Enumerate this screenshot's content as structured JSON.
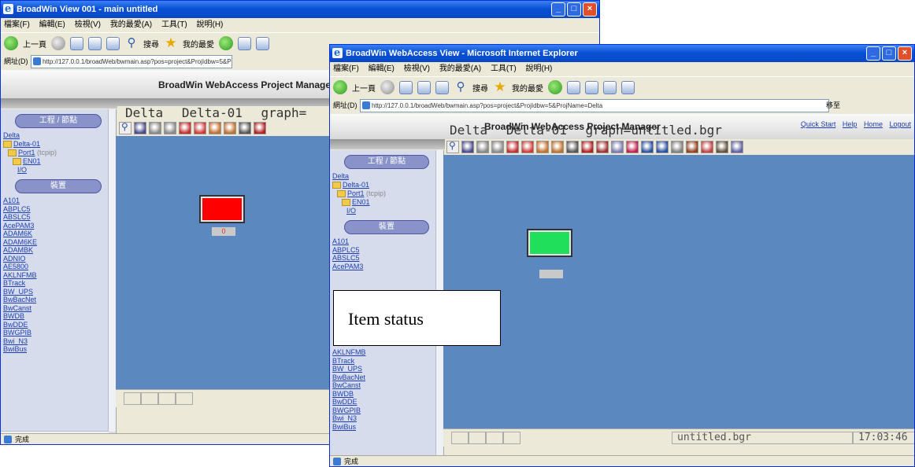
{
  "back_window": {
    "title": "BroadWin View 001 - main untitled",
    "menu": [
      "檔案(F)",
      "編輯(E)",
      "檢視(V)",
      "我的最愛(A)",
      "工具(T)",
      "說明(H)"
    ],
    "back_label": "上一頁",
    "search_label": "搜尋",
    "favorites_label": "我的最愛",
    "address_label": "網址(D)",
    "address_value": "http://127.0.0.1/broadWeb/bwmain.asp?pos=project&ProjIdbw=5&ProjName=Delta",
    "page_title": "BroadWin WebAccess Project Manage",
    "left_heading": "工程 / 節點",
    "tree": {
      "root": "Delta",
      "node": "Delta-01",
      "port": "Port1",
      "port_note": "(tcpip)",
      "device": "EN01",
      "io": "I/O"
    },
    "device_heading": "裝置",
    "device_list": [
      "A101",
      "ABPLC5",
      "ABSLC5",
      "AcePAM3",
      "ADAM6K",
      "ADAM6KE",
      "ADAMBK",
      "ADNIO",
      "AE5800",
      "AKLNFMB",
      "BTrack",
      "BW_UPS",
      "BwBacNet",
      "BwCanst",
      "BWDB",
      "BwDDE",
      "BWGPIB",
      "Bwi_N3",
      "BwiBus"
    ],
    "header_project": "Delta",
    "header_node": "Delta-01",
    "header_graph": "graph=",
    "item_value": "0",
    "status_text": "完成"
  },
  "front_window": {
    "title": "BroadWin WebAccess View - Microsoft Internet Explorer",
    "menu": [
      "檔案(F)",
      "編輯(E)",
      "檢視(V)",
      "我的最愛(A)",
      "工具(T)",
      "說明(H)"
    ],
    "back_label": "上一頁",
    "search_label": "搜尋",
    "favorites_label": "我的最愛",
    "address_label": "網址(D)",
    "address_value": "http://127.0.0.1/broadWeb/bwmain.asp?pos=project&ProjIdbw=5&ProjName=Delta",
    "go_label": "移至",
    "page_title": "BroadWin WebAccess Project Manager",
    "links": [
      "Quick Start",
      "Help",
      "Home",
      "Logout"
    ],
    "left_heading": "工程 / 節點",
    "tree": {
      "root": "Delta",
      "node": "Delta-01",
      "port": "Port1",
      "port_note": "(tcpip)",
      "device": "EN01",
      "io": "I/O"
    },
    "device_heading": "裝置",
    "device_list_top": [
      "A101",
      "ABPLC5",
      "ABSLC5",
      "AcePAM3"
    ],
    "device_list_bottom": [
      "AKLNFMB",
      "BTrack",
      "BW_UPS",
      "BwBacNet",
      "BwCanst",
      "BWDB",
      "BwDDE",
      "BWGPIB",
      "Bwi_N3",
      "BwiBus"
    ],
    "header_project": "Delta",
    "header_node": "Delta-01",
    "header_graph": "graph=untitled.bgr",
    "status_file": "untitled.bgr",
    "status_time": "17:03:46",
    "status_text": "完成"
  },
  "callout": {
    "label": "Item status"
  },
  "colors": {
    "canvas": "#5b89bf",
    "item_off": "#ff0000",
    "item_on": "#1fe05a"
  }
}
